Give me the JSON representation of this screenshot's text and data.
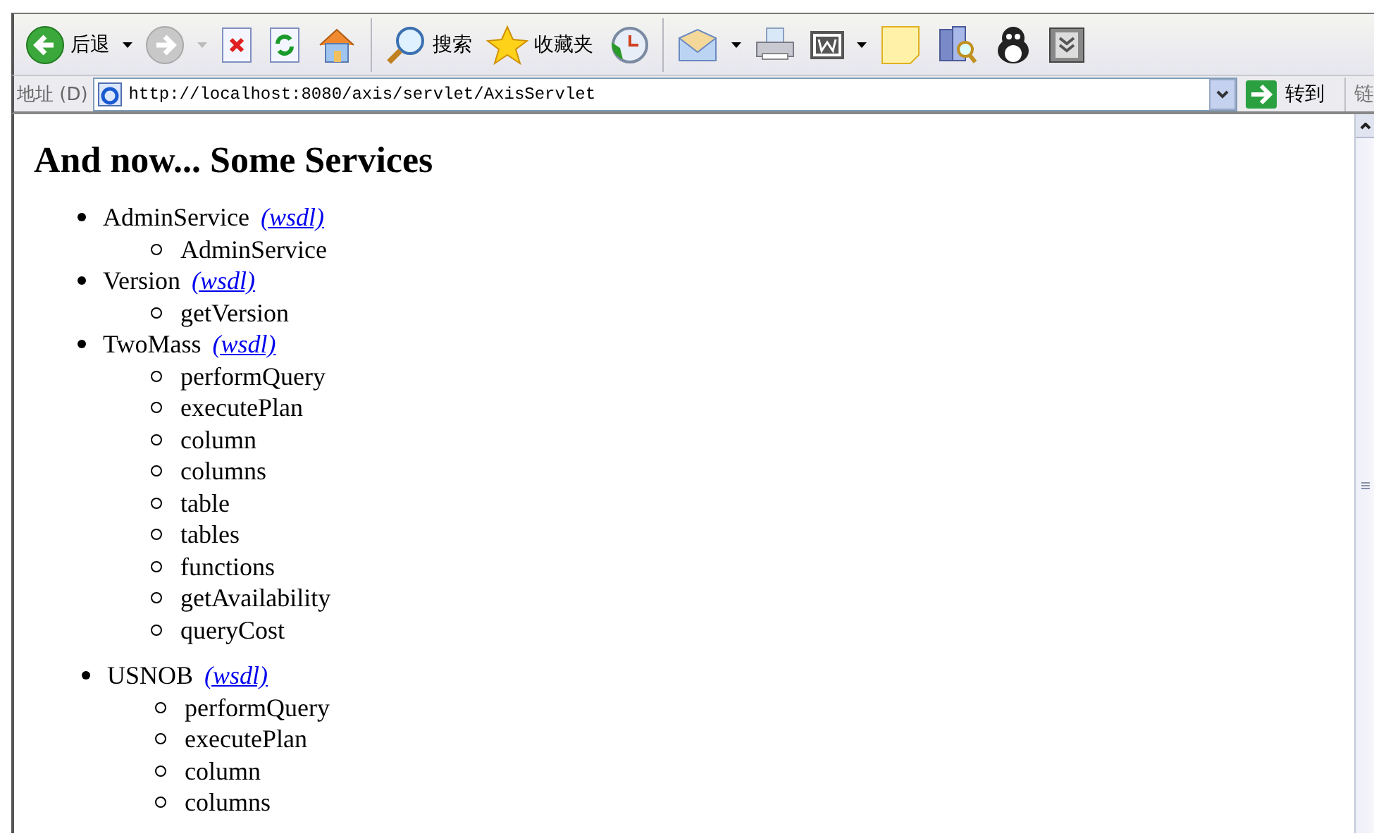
{
  "toolbar": [
    {
      "kind": "back",
      "label": "后退",
      "dropdown": true,
      "disabled": false
    },
    {
      "kind": "forward",
      "dropdown": true,
      "disabled": true
    },
    {
      "kind": "stop"
    },
    {
      "kind": "refresh"
    },
    {
      "kind": "home"
    },
    {
      "kind": "search",
      "label": "搜索"
    },
    {
      "kind": "favorites",
      "label": "收藏夹"
    },
    {
      "kind": "history"
    },
    {
      "kind": "mail",
      "dropdown": true
    },
    {
      "kind": "print"
    },
    {
      "kind": "word",
      "dropdown": true
    },
    {
      "kind": "note"
    },
    {
      "kind": "research"
    },
    {
      "kind": "penguin"
    },
    {
      "kind": "extra"
    }
  ],
  "address_bar": {
    "label": "地址 (D)",
    "value": "http://localhost:8080/axis/servlet/AxisServlet",
    "go": "转到",
    "links": "链"
  },
  "page": {
    "heading": "And now... Some Services",
    "services": [
      {
        "name": "AdminService",
        "link": "(wsdl)",
        "methods": [
          "AdminService"
        ]
      },
      {
        "name": "Version",
        "link": "(wsdl)",
        "methods": [
          "getVersion"
        ]
      },
      {
        "name": "TwoMass",
        "link": "(wsdl)",
        "methods": [
          "performQuery",
          "executePlan",
          "column",
          "columns",
          "table",
          "tables",
          "functions",
          "getAvailability",
          "queryCost"
        ]
      },
      {
        "name": "USNOB",
        "link": "(wsdl)",
        "methods": [
          "performQuery",
          "executePlan",
          "column",
          "columns"
        ]
      }
    ]
  }
}
